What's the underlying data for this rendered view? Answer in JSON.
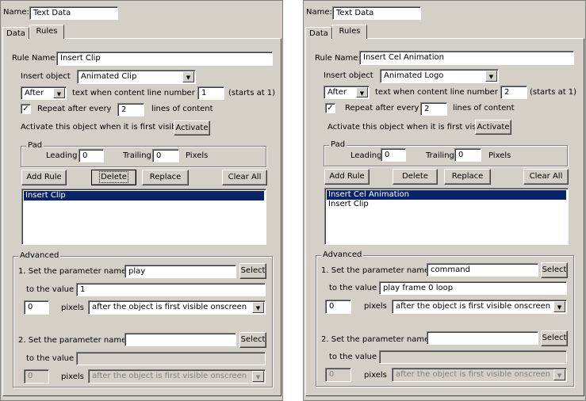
{
  "panels": [
    {
      "name_label": "Name:",
      "name_value": "Text Data",
      "tabs": [
        "Data",
        "Rules"
      ],
      "rule_name_label": "Rule Name:",
      "rule_name_value": "Insert Clip",
      "insert_object_label": "Insert object",
      "insert_object_value": "Animated Clip",
      "when_value": "After",
      "line_number_label": "text when content line number is",
      "line_number_value": "1",
      "starts_at_label": "(starts at 1)",
      "repeat_label": "Repeat after every",
      "repeat_checked": true,
      "repeat_value": "2",
      "lines_label": "lines of content",
      "activate_label": "Activate this object when it is first visible",
      "activate_button": "Activate",
      "pad_title": "Pad",
      "leading_label": "Leading",
      "leading_value": "0",
      "trailing_label": "Trailing",
      "trailing_value": "0",
      "pixels_label": "Pixels",
      "buttons": {
        "add": "Add Rule",
        "delete": "Delete",
        "replace": "Replace",
        "clear": "Clear All"
      },
      "rules_list": [
        "Insert Clip"
      ],
      "selected_index": 0,
      "advanced_title": "Advanced",
      "param1_label": "1. Set the parameter named",
      "param1_value": "play",
      "select_button": "Select",
      "to_value_label": "to the value",
      "value1": "1",
      "pixels1_value": "0",
      "pixels_word": "pixels",
      "timing1_value": "after the object is first visible onscreen",
      "param2_label": "2. Set the parameter named",
      "param2_value": "",
      "value2": "",
      "pixels2_value": "0",
      "timing2_value": "after the object is first visible onscreen"
    },
    {
      "name_label": "Name:",
      "name_value": "Text Data",
      "tabs": [
        "Data",
        "Rules"
      ],
      "rule_name_label": "Rule Name:",
      "rule_name_value": "Insert Cel Animation",
      "insert_object_label": "Insert object",
      "insert_object_value": "Animated Logo",
      "when_value": "After",
      "line_number_label": "text when content line number is",
      "line_number_value": "2",
      "starts_at_label": "(starts at 1)",
      "repeat_label": "Repeat after every",
      "repeat_checked": true,
      "repeat_value": "2",
      "lines_label": "lines of content",
      "activate_label": "Activate this object when it is first visible",
      "activate_button": "Activate",
      "pad_title": "Pad",
      "leading_label": "Leading",
      "leading_value": "0",
      "trailing_label": "Trailing",
      "trailing_value": "0",
      "pixels_label": "Pixels",
      "buttons": {
        "add": "Add Rule",
        "delete": "Delete",
        "replace": "Replace",
        "clear": "Clear All"
      },
      "rules_list": [
        "Insert Cel Animation",
        "Insert Clip"
      ],
      "selected_index": 0,
      "advanced_title": "Advanced",
      "param1_label": "1. Set the parameter named",
      "param1_value": "command",
      "select_button": "Select",
      "to_value_label": "to the value",
      "value1": "play frame 0 loop",
      "pixels1_value": "0",
      "pixels_word": "pixels",
      "timing1_value": "after the object is first visible onscreen",
      "param2_label": "2. Set the parameter named",
      "param2_value": "",
      "value2": "",
      "pixels2_value": "0",
      "timing2_value": "after the object is first visible onscreen"
    }
  ]
}
